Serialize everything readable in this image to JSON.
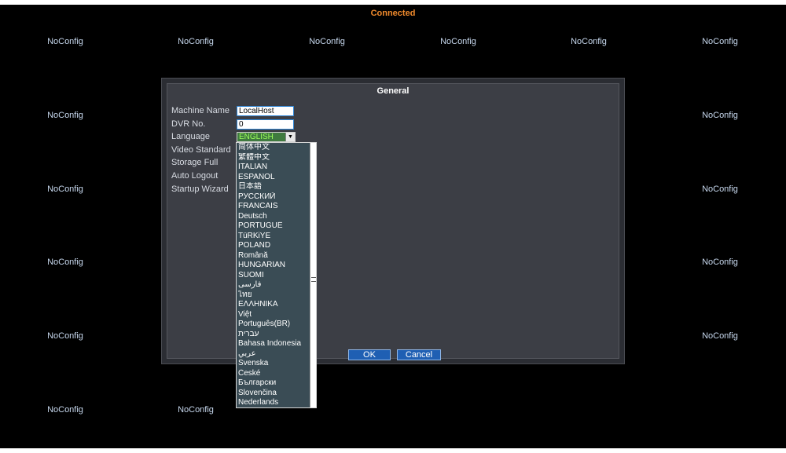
{
  "status": "Connected",
  "channels": [
    "NoConfig",
    "NoConfig",
    "NoConfig",
    "NoConfig",
    "NoConfig",
    "NoConfig",
    "NoConfig",
    "NoConfig",
    "NoConfig",
    "NoConfig",
    "NoConfig",
    "NoConfig",
    "NoConfig",
    "NoConfig",
    "NoConfig",
    "NoConfig",
    "NoConfig",
    "NoConfig"
  ],
  "dialog": {
    "title": "General",
    "labels": {
      "machine_name": "Machine Name",
      "dvr_no": "DVR No.",
      "language": "Language",
      "video_standard": "Video Standard",
      "storage_full": "Storage Full",
      "auto_logout": "Auto Logout",
      "startup_wizard": "Startup Wizard"
    },
    "values": {
      "machine_name": "LocalHost",
      "dvr_no": "0",
      "language": "ENGLISH"
    },
    "ok_label": "OK",
    "cancel_label": "Cancel"
  },
  "language_options": [
    "简体中文",
    "繁體中文",
    "ITALIAN",
    "ESPAÑOL",
    "日本語",
    "РУССКИЙ",
    "FRANCAIS",
    "Deutsch",
    "PORTUGUÊ",
    "TüRKiYE",
    "POLAND",
    "Română",
    "HUNGARIAN",
    "SUOMI",
    "فارسی",
    "ไทย",
    "ΕΛΛΗΝΙΚΑ",
    "Việt",
    "Português(BR)",
    "עברית",
    "Bahasa Indonesia",
    "عربي",
    "Svenska",
    "České",
    "Български",
    "Slovenčina",
    "Nederlands"
  ],
  "colors": {
    "status": "#f08a2c",
    "channel_label": "#c7d8ee",
    "selected_value": "#9cff5a",
    "button": "#1f5fb3"
  }
}
